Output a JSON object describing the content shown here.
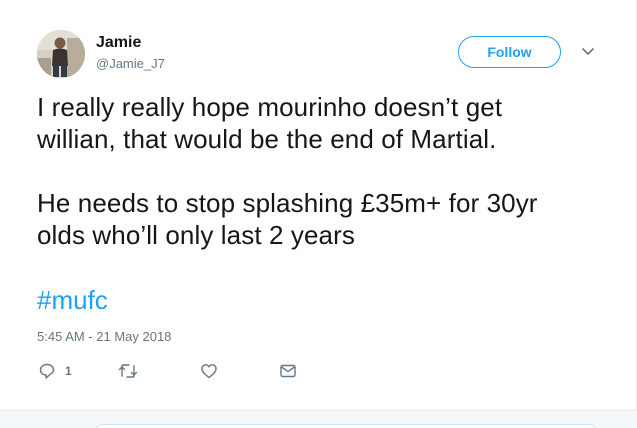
{
  "author": {
    "name": "Jamie",
    "handle": "@Jamie_J7"
  },
  "follow": {
    "label": "Follow"
  },
  "tweet": {
    "lines": [
      "I really really hope mourinho doesn’t get",
      "willian, that would be the end of Martial.",
      "",
      "He needs to stop splashing £35m+ for 30yr",
      "olds who’ll only last 2 years"
    ],
    "hashtag": "#mufc",
    "timestamp": "5:45 AM - 21 May 2018"
  },
  "actions": {
    "reply_count": "1",
    "icons": [
      "reply-icon",
      "retweet-icon",
      "like-icon",
      "direct-message-icon"
    ]
  },
  "colors": {
    "accent": "#1da1f2",
    "text": "#14171a",
    "secondary": "#657786",
    "divider": "#e6ecf0"
  }
}
